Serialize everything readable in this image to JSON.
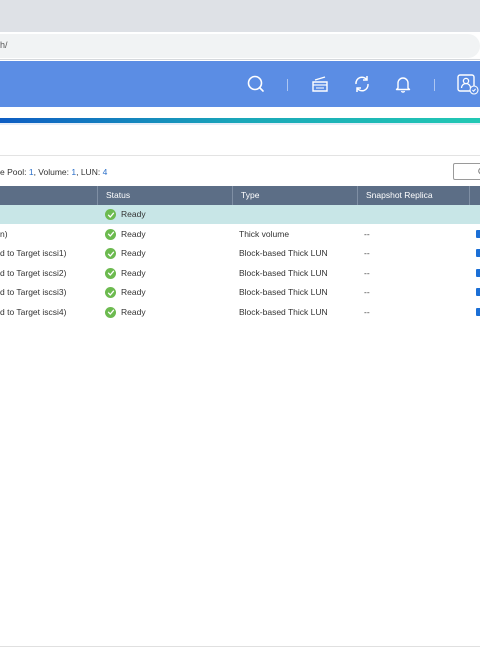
{
  "browser": {
    "url_fragment": "h/"
  },
  "header": {
    "icons": [
      "search-icon",
      "task-queue-icon",
      "sync-icon",
      "notification-bell-icon",
      "user-account-icon"
    ]
  },
  "summary": {
    "prefix": "e Pool: ",
    "pool_count": "1",
    "volume_label": ", Volume: ",
    "volume_count": "1",
    "lun_label": ", LUN: ",
    "lun_count": "4"
  },
  "table": {
    "columns": {
      "status": "Status",
      "type": "Type",
      "snapshot": "Snapshot Replica"
    },
    "rows": [
      {
        "name": "",
        "status": "Ready",
        "type": "",
        "snapshot": "",
        "selected": true,
        "mark": false
      },
      {
        "name": "n)",
        "status": "Ready",
        "type": "Thick volume",
        "snapshot": "--",
        "selected": false,
        "mark": true
      },
      {
        "name": "d to Target iscsi1)",
        "status": "Ready",
        "type": "Block-based Thick LUN",
        "snapshot": "--",
        "selected": false,
        "mark": true
      },
      {
        "name": "d to Target iscsi2)",
        "status": "Ready",
        "type": "Block-based Thick LUN",
        "snapshot": "--",
        "selected": false,
        "mark": true
      },
      {
        "name": "d to Target iscsi3)",
        "status": "Ready",
        "type": "Block-based Thick LUN",
        "snapshot": "--",
        "selected": false,
        "mark": true
      },
      {
        "name": "d to Target iscsi4)",
        "status": "Ready",
        "type": "Block-based Thick LUN",
        "snapshot": "--",
        "selected": false,
        "mark": true
      }
    ]
  },
  "colors": {
    "header_bg": "#5b8de4",
    "table_header_bg": "#5c6e86",
    "selected_row_bg": "#c8e6e7",
    "status_ok": "#6cba4f",
    "link_blue": "#2a6fc9"
  }
}
